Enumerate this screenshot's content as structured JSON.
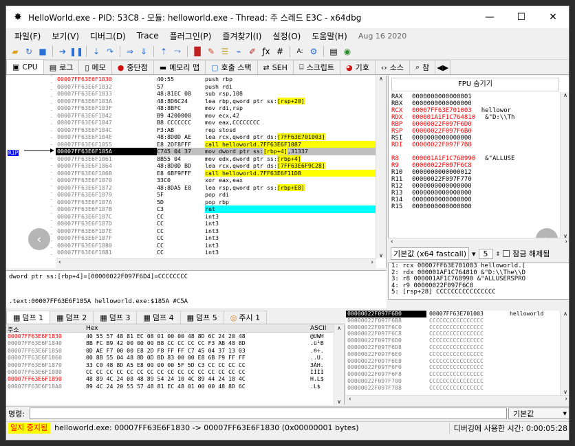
{
  "window": {
    "title": "HelloWorld.exe - PID: 53C8 - 모듈: helloworld.exe - Thread: 주 스레드 E3C - x64dbg",
    "minimize": "—",
    "maximize": "☐",
    "close": "✕"
  },
  "menu": {
    "items": [
      "파일(F)",
      "보기(V)",
      "디버그(D)",
      "Trace",
      "플러그인(P)",
      "즐겨찾기(I)",
      "설정(O)",
      "도움말(H)"
    ],
    "date": "Aug 16 2020"
  },
  "tabs": [
    {
      "label": "CPU",
      "icon": "cpu-icon"
    },
    {
      "label": "로그",
      "icon": "log-icon"
    },
    {
      "label": "메모",
      "icon": "notes-icon"
    },
    {
      "label": "중단점",
      "icon": "breakpoint-icon"
    },
    {
      "label": "메모리 맵",
      "icon": "memory-map-icon"
    },
    {
      "label": "호출 스택",
      "icon": "call-stack-icon"
    },
    {
      "label": "SEH",
      "icon": "seh-icon"
    },
    {
      "label": "스크립트",
      "icon": "script-icon"
    },
    {
      "label": "기호",
      "icon": "symbols-icon"
    },
    {
      "label": "소스",
      "icon": "source-icon"
    },
    {
      "label": "참",
      "icon": "references-icon"
    }
  ],
  "disasm": {
    "rip_label": "RIP",
    "rows": [
      {
        "addr": "00007FF63E6F1830",
        "bytes": "40:55",
        "instr": "push rbp"
      },
      {
        "addr": "00007FF63E6F1832",
        "bytes": "57",
        "instr": "push rdi"
      },
      {
        "addr": "00007FF63E6F1833",
        "bytes": "48:81EC 08",
        "instr": "sub rsp,108"
      },
      {
        "addr": "00007FF63E6F183A",
        "bytes": "48:8D6C24",
        "instr": "lea rbp,qword ptr ss:[rsp+20]"
      },
      {
        "addr": "00007FF63E6F183F",
        "bytes": "48:8BFC",
        "instr": "mov rdi,rsp"
      },
      {
        "addr": "00007FF63E6F1842",
        "bytes": "B9 4200000",
        "instr": "mov ecx,42"
      },
      {
        "addr": "00007FF63E6F1847",
        "bytes": "B8 CCCCCCC",
        "instr": "mov eax,CCCCCCCC"
      },
      {
        "addr": "00007FF63E6F184C",
        "bytes": "F3:AB",
        "instr": "rep stosd"
      },
      {
        "addr": "00007FF63E6F184E",
        "bytes": "48:8D0D AE",
        "instr": "lea rcx,qword ptr ds:[7FF63E701003]"
      },
      {
        "addr": "00007FF63E6F1855",
        "bytes": "E8 2DF8FFF",
        "instr": "call helloworld.7FF63E6F1087"
      },
      {
        "addr": "00007FF63E6F185A",
        "bytes": "C745 04 37",
        "instr": "mov dword ptr ss:[rbp+4],31337"
      },
      {
        "addr": "00007FF63E6F1861",
        "bytes": "8B55 04",
        "instr": "mov edx,dword ptr ss:[rbp+4]"
      },
      {
        "addr": "00007FF63E6F1864",
        "bytes": "48:8D0D BD",
        "instr": "lea rcx,qword ptr ds:[7FF63E6F9C28]"
      },
      {
        "addr": "00007FF63E6F186B",
        "bytes": "E8 6BF9FFF",
        "instr": "call helloworld.7FF63E6F11DB"
      },
      {
        "addr": "00007FF63E6F1870",
        "bytes": "33C0",
        "instr": "xor eax,eax"
      },
      {
        "addr": "00007FF63E6F1872",
        "bytes": "48:8DA5 E8",
        "instr": "lea rsp,qword ptr ss:[rbp+E8]"
      },
      {
        "addr": "00007FF63E6F1879",
        "bytes": "5F",
        "instr": "pop rdi"
      },
      {
        "addr": "00007FF63E6F187A",
        "bytes": "5D",
        "instr": "pop rbp"
      },
      {
        "addr": "00007FF63E6F187B",
        "bytes": "C3",
        "instr": "ret"
      },
      {
        "addr": "00007FF63E6F187C",
        "bytes": "CC",
        "instr": "int3"
      },
      {
        "addr": "00007FF63E6F187D",
        "bytes": "CC",
        "instr": "int3"
      },
      {
        "addr": "00007FF63E6F187E",
        "bytes": "CC",
        "instr": "int3"
      },
      {
        "addr": "00007FF63E6F187F",
        "bytes": "CC",
        "instr": "int3"
      },
      {
        "addr": "00007FF63E6F1880",
        "bytes": "CC",
        "instr": "int3"
      },
      {
        "addr": "00007FF63E6F1881",
        "bytes": "CC",
        "instr": "int3"
      }
    ]
  },
  "info": {
    "line1": "dword ptr ss:[rbp+4]=[00000022F097F6D4]=CCCCCCCC",
    "line2": ".text:00007FF63E6F185A helloworld.exe:$185A #C5A"
  },
  "fpu": {
    "title": "FPU 숨기기",
    "registers": [
      {
        "name": "RAX",
        "value": "0000000000000001",
        "comment": ""
      },
      {
        "name": "RBX",
        "value": "0000000000000000",
        "comment": ""
      },
      {
        "name": "RCX",
        "value": "00007FF63E701003",
        "comment": "hellowor"
      },
      {
        "name": "RDX",
        "value": "000001A1F1C764810",
        "comment": "&\"D:\\\\Th"
      },
      {
        "name": "RBP",
        "value": "00000022F097F6D0",
        "comment": ""
      },
      {
        "name": "RSP",
        "value": "00000022F097F6B0",
        "comment": ""
      },
      {
        "name": "RSI",
        "value": "0000000000000000",
        "comment": ""
      },
      {
        "name": "RDI",
        "value": "00000022F097F7B8",
        "comment": ""
      },
      {
        "name": "R8",
        "value": "000001A1F1C768990",
        "comment": "&\"ALLUSE"
      },
      {
        "name": "R9",
        "value": "00000022F097F6C8",
        "comment": ""
      },
      {
        "name": "R10",
        "value": "0000000000000012",
        "comment": ""
      },
      {
        "name": "R11",
        "value": "00000022F097F770",
        "comment": ""
      },
      {
        "name": "R12",
        "value": "0000000000000000",
        "comment": ""
      },
      {
        "name": "R13",
        "value": "0000000000000000",
        "comment": ""
      },
      {
        "name": "R14",
        "value": "0000000000000000",
        "comment": ""
      },
      {
        "name": "R15",
        "value": "0000000000000000",
        "comment": ""
      }
    ]
  },
  "callconv": {
    "label": "기본값 (x64 fastcall)",
    "count": "5",
    "lock_label": "잠금 해제됨"
  },
  "stackargs": [
    "1: rcx 00007FF63E701003 helloworld.(",
    "2: rdx 000001AF1C764810 &\"D:\\\\The\\\\D",
    "3: r8 000001AF1C768990 &\"ALLUSERSPRO",
    "4: r9 00000022F097F6C8",
    "5: [rsp+28] CCCCCCCCCCCCCCCC"
  ],
  "dump_tabs": [
    "덤프 1",
    "덤프 2",
    "덤프 3",
    "덤프 4",
    "덤프 5",
    "주시 1"
  ],
  "dump": {
    "col_addr": "주소",
    "col_hex": "Hex",
    "col_ascii": "ASCII",
    "rows": [
      {
        "addr": "00007FF63E6F1830",
        "hex": "40 55 57 48 81 EC 08 01 00 00 48 8D 6C 24 20 48",
        "ascii": "@UWH"
      },
      {
        "addr": "00007FF63E6F1840",
        "hex": "8B FC B9 42 00 00 00 B8 CC CC CC CC F3 AB 48 8D",
        "ascii": ".ü¹B"
      },
      {
        "addr": "00007FF63E6F1850",
        "hex": "0D AE F7 00 00 E8 2D F8 FF FF C7 45 04 37 13 03",
        "ascii": ".®÷."
      },
      {
        "addr": "00007FF63E6F1860",
        "hex": "00 8B 55 04 48 8D 0D BD 83 00 00 E8 6B F9 FF FF",
        "ascii": "..U."
      },
      {
        "addr": "00007FF63E6F1870",
        "hex": "33 C0 48 8D A5 E8 00 00 00 5F 5D C3 CC CC CC CC",
        "ascii": "3ÀH."
      },
      {
        "addr": "00007FF63E6F1880",
        "hex": "CC CC CC CC CC CC CC CC CC CC CC CC CC CC CC CC",
        "ascii": "ÌÌÌÌ"
      },
      {
        "addr": "00007FF63E6F1890",
        "hex": "48 89 4C 24 08 48 89 54 24 10 4C 89 44 24 18 4C",
        "ascii": "H.L$"
      },
      {
        "addr": "00007FF63E6F18A0",
        "hex": "89 4C 24 20 55 57 48 81 EC 48 01 00 00 48 8D 6C",
        "ascii": ".L$ "
      }
    ]
  },
  "stack": {
    "rows": [
      {
        "addr": "00000022F097F6B0",
        "value": "00007FF63E701003",
        "comment": "helloworld"
      },
      {
        "addr": "00000022F097F6B8",
        "value": "CCCCCCCCCCCCCCCC",
        "comment": ""
      },
      {
        "addr": "00000022F097F6C0",
        "value": "CCCCCCCCCCCCCCCC",
        "comment": ""
      },
      {
        "addr": "00000022F097F6C8",
        "value": "CCCCCCCCCCCCCCCC",
        "comment": ""
      },
      {
        "addr": "00000022F097F6D0",
        "value": "CCCCCCCCCCCCCCCC",
        "comment": ""
      },
      {
        "addr": "00000022F097F6D8",
        "value": "CCCCCCCCCCCCCCCC",
        "comment": ""
      },
      {
        "addr": "00000022F097F6E0",
        "value": "CCCCCCCCCCCCCCCC",
        "comment": ""
      },
      {
        "addr": "00000022F097F6E8",
        "value": "CCCCCCCCCCCCCCCC",
        "comment": ""
      },
      {
        "addr": "00000022F097F6F0",
        "value": "CCCCCCCCCCCCCCCC",
        "comment": ""
      },
      {
        "addr": "00000022F097F6F8",
        "value": "CCCCCCCCCCCCCCCC",
        "comment": ""
      },
      {
        "addr": "00000022F097F700",
        "value": "CCCCCCCCCCCCCCCC",
        "comment": ""
      },
      {
        "addr": "00000022F097F708",
        "value": "CCCCCCCCCCCCCCCC",
        "comment": ""
      }
    ]
  },
  "command": {
    "label": "명령:",
    "value": "",
    "mode": "기본값"
  },
  "status": {
    "state": "일지 중지됨",
    "message": "helloworld.exe: 00007FF63E6F1830 -> 00007FF63E6F1830 (0x00000001 bytes)",
    "time": "디버깅에 사용한 시간: 0:00:05:28"
  },
  "colors": {
    "accent_red": "#ff0000",
    "highlight_yellow": "#ffff00",
    "ret_cyan": "#00ffff",
    "rip_blue": "#0000ff"
  }
}
